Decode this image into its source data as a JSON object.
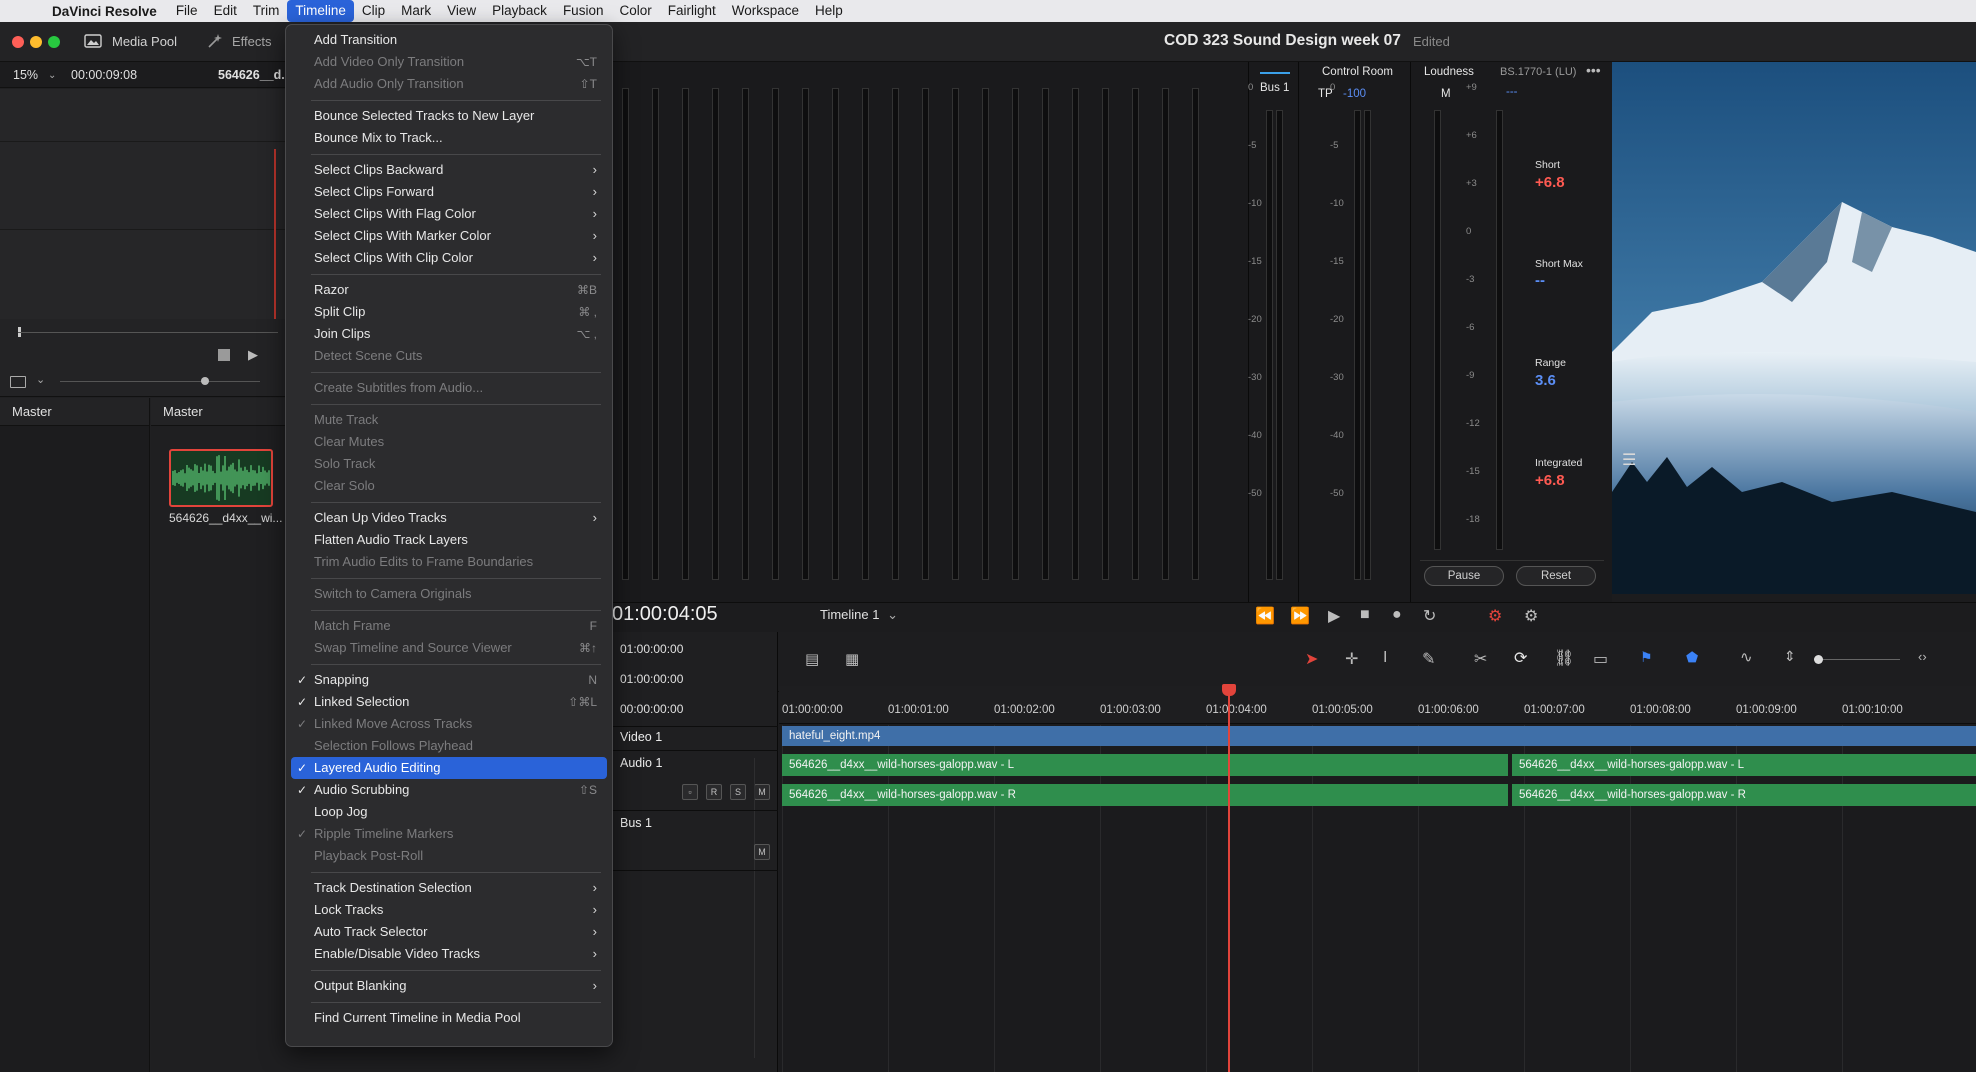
{
  "menubar": {
    "app": "DaVinci Resolve",
    "items": [
      "File",
      "Edit",
      "Trim",
      "Timeline",
      "Clip",
      "Mark",
      "View",
      "Playback",
      "Fusion",
      "Color",
      "Fairlight",
      "Workspace",
      "Help"
    ],
    "active": "Timeline"
  },
  "window": {
    "tabs": [
      "Media Pool",
      "Effects"
    ],
    "project_title": "COD 323 Sound Design week 07",
    "project_status": "Edited"
  },
  "source": {
    "zoom": "15%",
    "timecode": "00:00:09:08",
    "clip_name": "564626__d..."
  },
  "mediapool": {
    "bins_header": "Master",
    "clips_header": "Master",
    "clip_label": "564626__d4xx__wi..."
  },
  "meters": {
    "bus_label": "Bus 1",
    "control_room": "Control Room",
    "tp_label": "TP",
    "tp_value": "-100",
    "loudness_label": "Loudness",
    "loudness_standard": "BS.1770-1 (LU)",
    "m_label": "M",
    "m_value": "---",
    "db_ticks": [
      "0",
      "-5",
      "-10",
      "-15",
      "-20",
      "-30",
      "-40",
      "-50"
    ],
    "lu_ticks": [
      "+9",
      "+6",
      "+3",
      "0",
      "-3",
      "-6",
      "-9",
      "-12",
      "-15",
      "-18"
    ],
    "short_label": "Short",
    "short_value": "+6.8",
    "short_max_label": "Short Max",
    "short_max_value": "--",
    "range_label": "Range",
    "range_value": "3.6",
    "integrated_label": "Integrated",
    "integrated_value": "+6.8",
    "pause_btn": "Pause",
    "reset_btn": "Reset"
  },
  "transport": {
    "timecode": "01:00:04:05",
    "timeline_name": "Timeline 1"
  },
  "timeline": {
    "tc_rows": [
      "01:00:00:00",
      "01:00:00:00",
      "00:00:00:00"
    ],
    "ruler": [
      "01:00:00:00",
      "01:00:01:00",
      "01:00:02:00",
      "01:00:03:00",
      "01:00:04:00",
      "01:00:05:00",
      "01:00:06:00",
      "01:00:07:00",
      "01:00:08:00",
      "01:00:09:00",
      "01:00:10:00"
    ],
    "tracks": {
      "video": "Video 1",
      "audio": "Audio 1",
      "bus": "Bus 1"
    },
    "clips": {
      "video": "hateful_eight.mp4",
      "audio_l1": "564626__d4xx__wild-horses-galopp.wav - L",
      "audio_r1": "564626__d4xx__wild-horses-galopp.wav - R",
      "audio_l2": "564626__d4xx__wild-horses-galopp.wav - L",
      "audio_r2": "564626__d4xx__wild-horses-galopp.wav - R"
    },
    "btn_r": "R",
    "btn_s": "S",
    "btn_m": "M"
  },
  "timeline_menu": [
    {
      "label": "Add Transition"
    },
    {
      "label": "Add Video Only Transition",
      "shortcut": "⌥T",
      "disabled": true
    },
    {
      "label": "Add Audio Only Transition",
      "shortcut": "⇧T",
      "disabled": true
    },
    {
      "sep": true
    },
    {
      "label": "Bounce Selected Tracks to New Layer"
    },
    {
      "label": "Bounce Mix to Track..."
    },
    {
      "sep": true
    },
    {
      "label": "Select Clips Backward",
      "submenu": true
    },
    {
      "label": "Select Clips Forward",
      "submenu": true
    },
    {
      "label": "Select Clips With Flag Color",
      "submenu": true
    },
    {
      "label": "Select Clips With Marker Color",
      "submenu": true
    },
    {
      "label": "Select Clips With Clip Color",
      "submenu": true
    },
    {
      "sep": true
    },
    {
      "label": "Razor",
      "shortcut": "⌘B"
    },
    {
      "label": "Split Clip",
      "shortcut": "⌘ ,"
    },
    {
      "label": "Join Clips",
      "shortcut": "⌥ ,"
    },
    {
      "label": "Detect Scene Cuts",
      "disabled": true
    },
    {
      "sep": true
    },
    {
      "label": "Create Subtitles from Audio...",
      "disabled": true
    },
    {
      "sep": true
    },
    {
      "label": "Mute Track",
      "disabled": true
    },
    {
      "label": "Clear Mutes",
      "disabled": true
    },
    {
      "label": "Solo Track",
      "disabled": true
    },
    {
      "label": "Clear Solo",
      "disabled": true
    },
    {
      "sep": true
    },
    {
      "label": "Clean Up Video Tracks",
      "submenu": true
    },
    {
      "label": "Flatten Audio Track Layers"
    },
    {
      "label": "Trim Audio Edits to Frame Boundaries",
      "disabled": true
    },
    {
      "sep": true
    },
    {
      "label": "Switch to Camera Originals",
      "disabled": true
    },
    {
      "sep": true
    },
    {
      "label": "Match Frame",
      "shortcut": "F",
      "disabled": true
    },
    {
      "label": "Swap Timeline and Source Viewer",
      "shortcut": "⌘↑",
      "disabled": true
    },
    {
      "sep": true
    },
    {
      "label": "Snapping",
      "shortcut": "N",
      "checked": true
    },
    {
      "label": "Linked Selection",
      "shortcut": "⇧⌘L",
      "checked": true
    },
    {
      "label": "Linked Move Across Tracks",
      "checked": true,
      "disabled": true
    },
    {
      "label": "Selection Follows Playhead",
      "disabled": true
    },
    {
      "label": "Layered Audio Editing",
      "checked": true,
      "highlighted": true
    },
    {
      "label": "Audio Scrubbing",
      "shortcut": "⇧S",
      "checked": true
    },
    {
      "label": "Loop Jog"
    },
    {
      "label": "Ripple Timeline Markers",
      "checked": true,
      "disabled": true
    },
    {
      "label": "Playback Post-Roll",
      "disabled": true
    },
    {
      "sep": true
    },
    {
      "label": "Track Destination Selection",
      "submenu": true
    },
    {
      "label": "Lock Tracks",
      "submenu": true
    },
    {
      "label": "Auto Track Selector",
      "submenu": true
    },
    {
      "label": "Enable/Disable Video Tracks",
      "submenu": true
    },
    {
      "sep": true
    },
    {
      "label": "Output Blanking",
      "submenu": true
    },
    {
      "sep": true
    },
    {
      "label": "Find Current Timeline in Media Pool"
    }
  ],
  "colors": {
    "accent": "#2a63d9",
    "playhead": "#e2443b",
    "audio_clip": "#2f8e4d",
    "video_clip": "#3f6fa8",
    "loudness_red": "#ff5a52",
    "loudness_blue": "#5b8ef5"
  }
}
